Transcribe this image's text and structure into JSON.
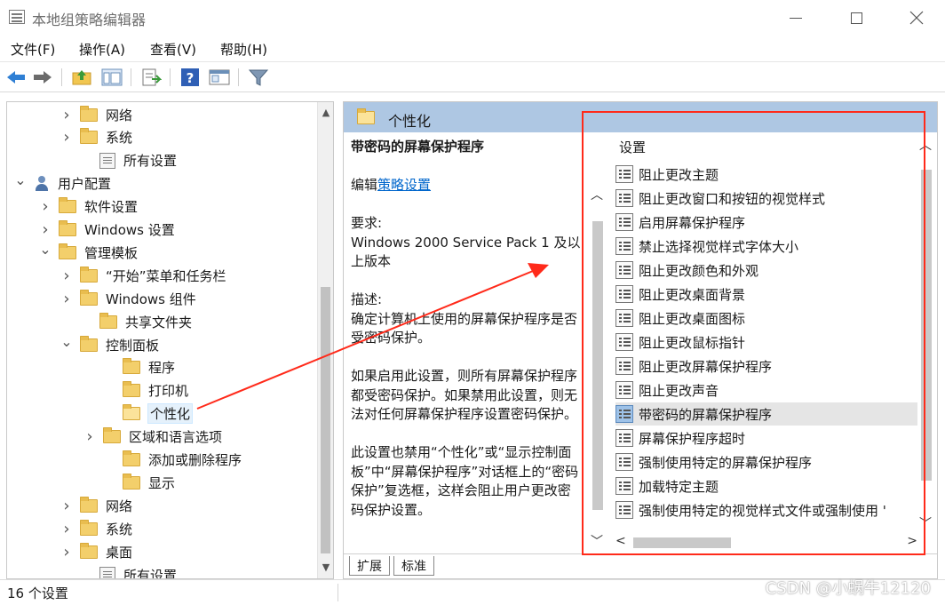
{
  "window": {
    "title": "本地组策略编辑器"
  },
  "menu": [
    "文件(F)",
    "操作(A)",
    "查看(V)",
    "帮助(H)"
  ],
  "tree": {
    "items": [
      {
        "label": "网络",
        "chevron": ">",
        "icon": "folder"
      },
      {
        "label": "系统",
        "chevron": ">",
        "icon": "folder"
      },
      {
        "label": "所有设置",
        "chevron": "",
        "icon": "settings-doc"
      },
      {
        "label": "用户配置",
        "chevron": "v",
        "icon": "user"
      },
      {
        "label": "软件设置",
        "chevron": ">",
        "icon": "folder"
      },
      {
        "label": "Windows 设置",
        "chevron": ">",
        "icon": "folder"
      },
      {
        "label": "管理模板",
        "chevron": "v",
        "icon": "folder"
      },
      {
        "label": "“开始”菜单和任务栏",
        "chevron": ">",
        "icon": "folder"
      },
      {
        "label": "Windows 组件",
        "chevron": ">",
        "icon": "folder"
      },
      {
        "label": "共享文件夹",
        "chevron": "",
        "icon": "folder"
      },
      {
        "label": "控制面板",
        "chevron": "v",
        "icon": "folder"
      },
      {
        "label": "程序",
        "chevron": "",
        "icon": "folder"
      },
      {
        "label": "打印机",
        "chevron": "",
        "icon": "folder"
      },
      {
        "label": "个性化",
        "chevron": "",
        "icon": "folder-open",
        "selected": true
      },
      {
        "label": "区域和语言选项",
        "chevron": ">",
        "icon": "folder"
      },
      {
        "label": "添加或删除程序",
        "chevron": "",
        "icon": "folder"
      },
      {
        "label": "显示",
        "chevron": "",
        "icon": "folder"
      },
      {
        "label": "网络",
        "chevron": ">",
        "icon": "folder"
      },
      {
        "label": "系统",
        "chevron": ">",
        "icon": "folder"
      },
      {
        "label": "桌面",
        "chevron": ">",
        "icon": "folder"
      },
      {
        "label": "所有设置",
        "chevron": "",
        "icon": "settings-doc"
      }
    ]
  },
  "panel": {
    "header": "个性化",
    "description": {
      "title": "带密码的屏幕保护程序",
      "edit_prefix": "编辑",
      "edit_link": "策略设置",
      "requirements_label": "要求:",
      "requirements_text": "Windows 2000 Service Pack 1 及以上版本",
      "description_label": "描述:",
      "description_text": "确定计算机上使用的屏幕保护程序是否受密码保护。",
      "para2": "如果启用此设置，则所有屏幕保护程序都受密码保护。如果禁用此设置，则无法对任何屏幕保护程序设置密码保护。",
      "para3": "此设置也禁用“个性化”或“显示控制面板”中“屏幕保护程序”对话框上的“密码保护”复选框，这样会阻止用户更改密码保护设置。"
    },
    "tabs": [
      "扩展",
      "标准"
    ],
    "settings_header": "设置",
    "settings": [
      "阻止更改主题",
      "阻止更改窗口和按钮的视觉样式",
      "启用屏幕保护程序",
      "禁止选择视觉样式字体大小",
      "阻止更改颜色和外观",
      "阻止更改桌面背景",
      "阻止更改桌面图标",
      "阻止更改鼠标指针",
      "阻止更改屏幕保护程序",
      "阻止更改声音",
      "带密码的屏幕保护程序",
      "屏幕保护程序超时",
      "强制使用特定的屏幕保护程序",
      "加载特定主题",
      "强制使用特定的视觉样式文件或强制使用 '"
    ],
    "selected_setting": "带密码的屏幕保护程序"
  },
  "status": {
    "count_text": "16 个设置"
  },
  "watermark": "CSDN @小蜗牛12120",
  "colors": {
    "header_blue": "#aec7e3",
    "annotation_red": "#ff2a1a",
    "link_blue": "#0066cc"
  }
}
